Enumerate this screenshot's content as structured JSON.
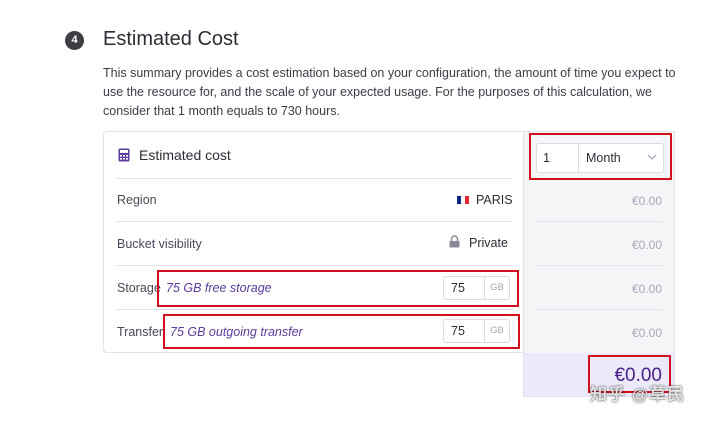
{
  "section": {
    "step_number": "4",
    "title": "Estimated Cost",
    "description": "This summary provides a cost estimation based on your configuration, the amount of time you expect to use the resource for, and the scale of your expected usage. For the purposes of this calculation, we consider that 1 month equals to 730 hours."
  },
  "card": {
    "title": "Estimated cost",
    "icon": "calculator-icon"
  },
  "period": {
    "quantity": "1",
    "unit": "Month"
  },
  "rows": [
    {
      "label": "Region",
      "value": "PARIS",
      "icon": "france-flag-icon",
      "price": "€0.00"
    },
    {
      "label": "Bucket visibility",
      "value": "Private",
      "icon": "lock-icon",
      "price": "€0.00"
    },
    {
      "label": "Storage",
      "description": "75 GB free storage",
      "input_value": "75",
      "unit": "GB",
      "price": "€0.00"
    },
    {
      "label": "Transfer",
      "description": "75 GB outgoing transfer",
      "input_value": "75",
      "unit": "GB",
      "price": "€0.00"
    }
  ],
  "total": "€0.00",
  "watermark": "知乎 @草民",
  "colors": {
    "accent": "#4a1e8a",
    "highlight": "#d10f1d",
    "flag_blue": "#0c2680",
    "flag_white": "#ffffff",
    "flag_red": "#e1252a"
  }
}
